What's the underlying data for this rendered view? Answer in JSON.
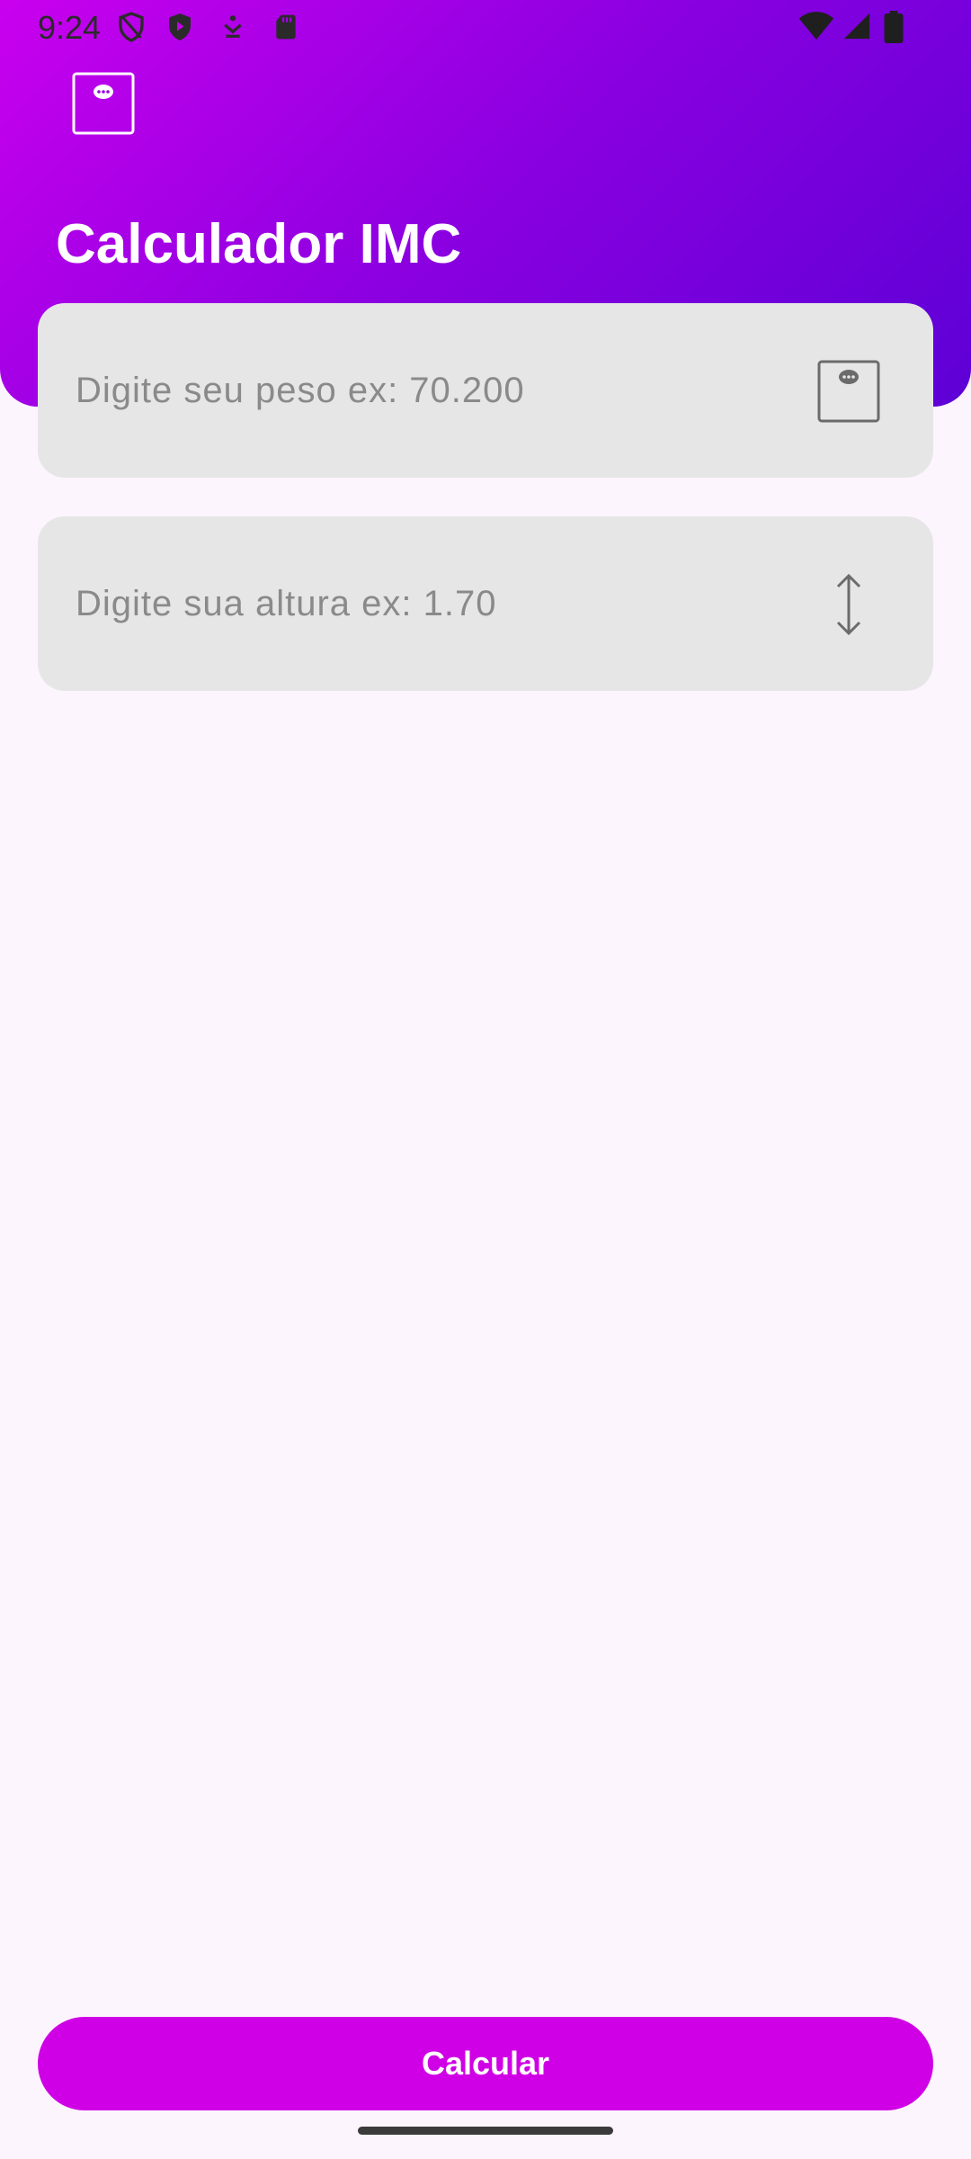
{
  "status_bar": {
    "time": "9:24",
    "left_icons": [
      "shield-outline-icon",
      "play-shield-icon",
      "download-icon",
      "sd-card-icon"
    ],
    "right_icons": [
      "wifi-icon",
      "signal-icon",
      "battery-icon"
    ]
  },
  "header": {
    "title": "Calculador IMC",
    "gradient": [
      "#c900ee",
      "#8a00e0",
      "#5d00d6"
    ]
  },
  "inputs": {
    "weight": {
      "placeholder": "Digite seu peso ex: 70.200",
      "value": "",
      "icon": "scale-icon"
    },
    "height": {
      "placeholder": "Digite sua altura ex: 1.70",
      "value": "",
      "icon": "vertical-arrows-icon"
    }
  },
  "actions": {
    "calculate_label": "Calcular"
  },
  "colors": {
    "accent": "#d000e6",
    "background": "#fdf5fd",
    "field_bg": "#e7e6e7"
  }
}
